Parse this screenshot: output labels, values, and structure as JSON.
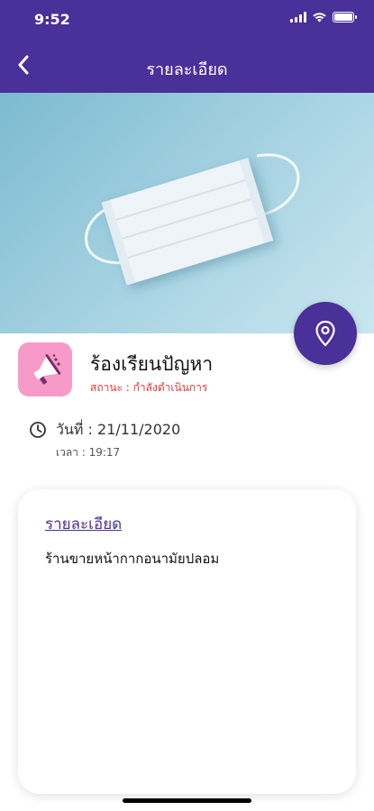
{
  "status_bar": {
    "time": "9:52"
  },
  "nav": {
    "title": "รายละเอียด"
  },
  "report": {
    "category": "ร้องเรียนปัญหา",
    "status": "สถานะ : กำลังดำเนินการ",
    "date": "วันที่ : 21/11/2020",
    "time": "เวลา : 19:17"
  },
  "detail": {
    "title": "รายละเอียด",
    "body": "ร้านขายหน้ากากอนามัยปลอม"
  },
  "colors": {
    "primary": "#4a3099",
    "status_red": "#e53935",
    "category_pink": "#f79ac7"
  },
  "icons": [
    "back-arrow-icon",
    "location-pin-icon",
    "megaphone-icon",
    "clock-icon",
    "wifi-icon",
    "battery-icon",
    "signal-icon"
  ]
}
